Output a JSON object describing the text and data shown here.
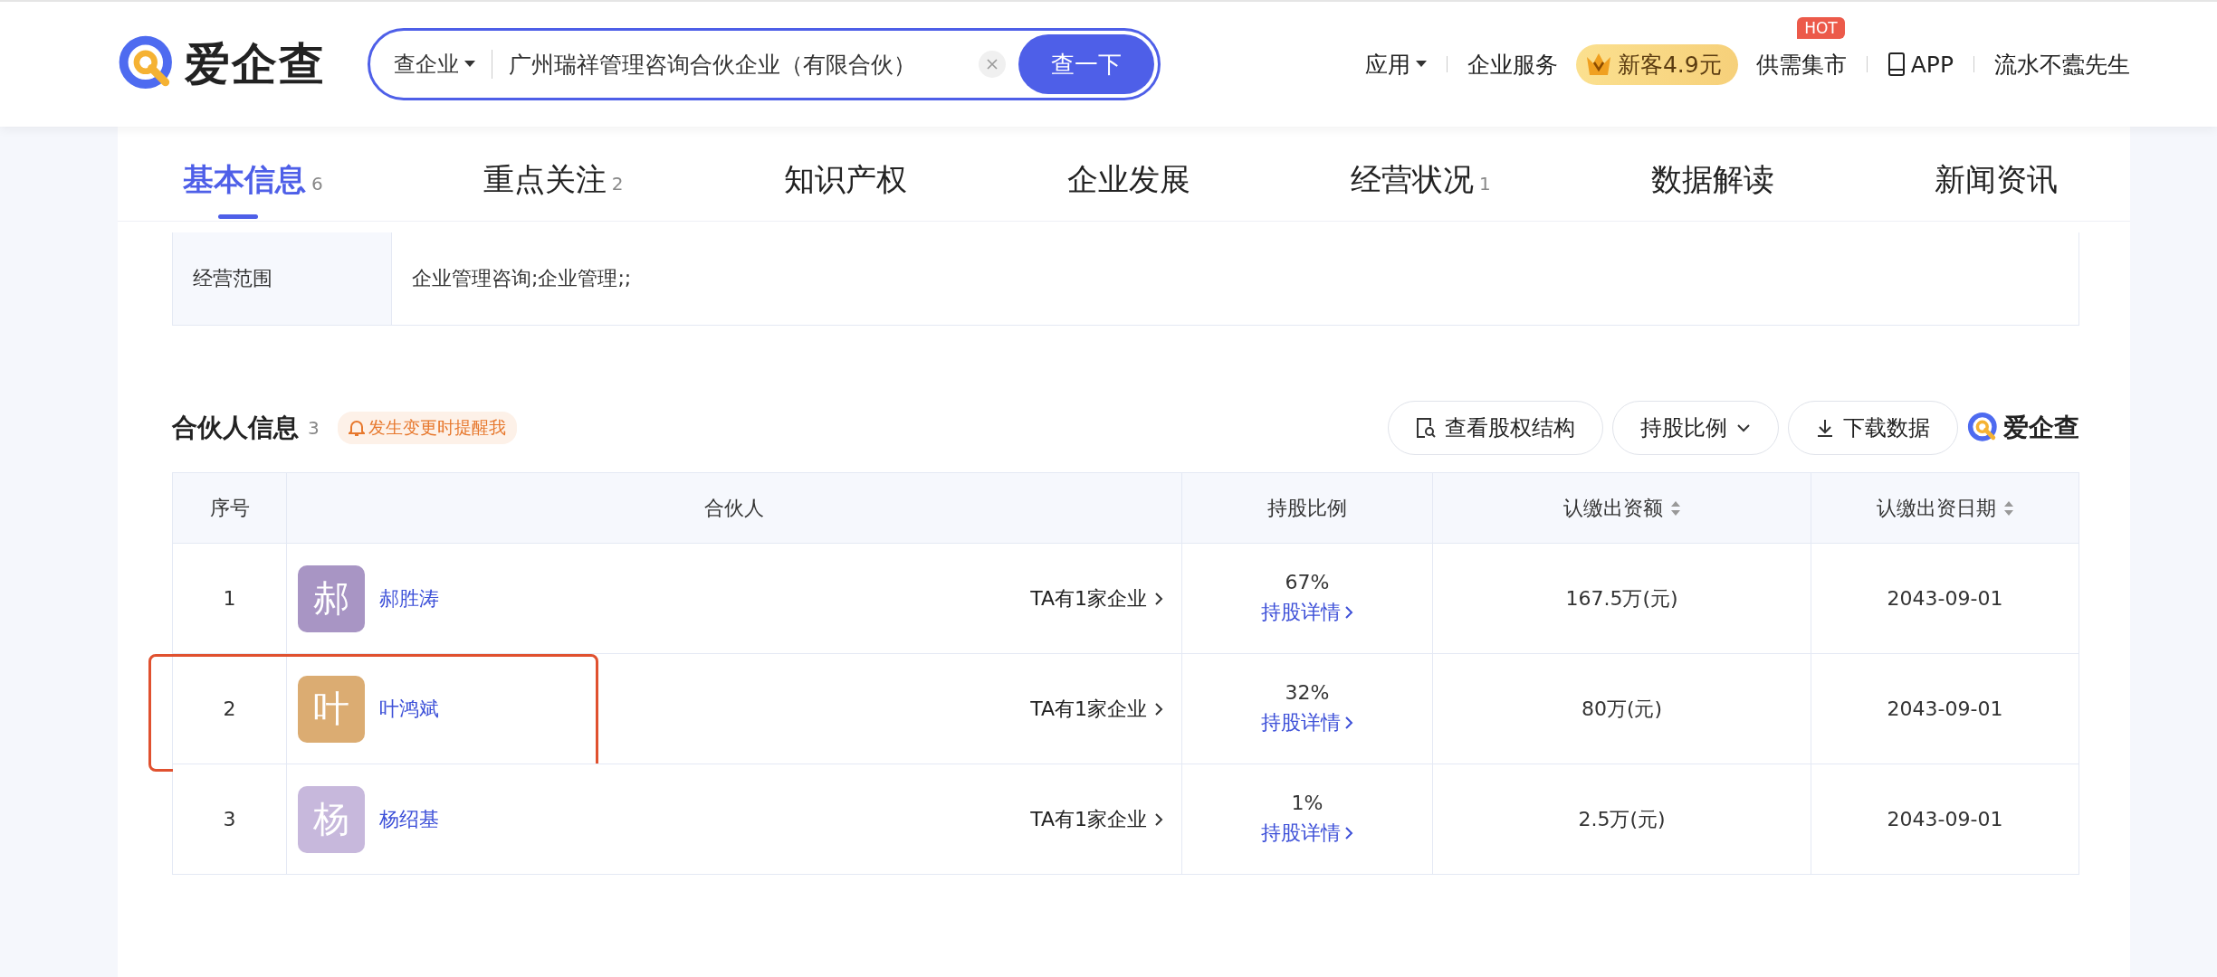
{
  "header": {
    "logo_text": "爱企查",
    "search": {
      "scope": "查企业",
      "value": "广州瑞祥管理咨询合伙企业（有限合伙）",
      "button": "查一下"
    },
    "nav": [
      {
        "kind": "dropdown",
        "label": "应用"
      },
      {
        "kind": "link",
        "label": "企业服务"
      },
      {
        "kind": "promo",
        "label": "新客4.9元"
      },
      {
        "kind": "hot",
        "label": "供需集市",
        "badge": "HOT"
      },
      {
        "kind": "app",
        "label": "APP"
      },
      {
        "kind": "user",
        "label": "流水不蠹先生"
      }
    ]
  },
  "tabs": [
    {
      "label": "基本信息",
      "count": "6",
      "selected": true
    },
    {
      "label": "重点关注",
      "count": "2",
      "selected": false
    },
    {
      "label": "知识产权",
      "selected": false
    },
    {
      "label": "企业发展",
      "selected": false
    },
    {
      "label": "经营状况",
      "count": "1",
      "selected": false
    },
    {
      "label": "数据解读",
      "selected": false
    },
    {
      "label": "新闻资讯",
      "selected": false
    }
  ],
  "business_scope": {
    "label": "经营范围",
    "value": "企业管理咨询;企业管理;;"
  },
  "partners": {
    "title": "合伙人信息",
    "count": "3",
    "remind": "发生变更时提醒我",
    "actions": [
      {
        "kind": "structure",
        "label": "查看股权结构"
      },
      {
        "kind": "dropdown",
        "label": "持股比例"
      },
      {
        "kind": "download",
        "label": "下载数据"
      }
    ],
    "brand": "爱企查",
    "columns": [
      {
        "label": "序号",
        "sortable": false
      },
      {
        "label": "合伙人",
        "sortable": false
      },
      {
        "label": "持股比例",
        "sortable": false
      },
      {
        "label": "认缴出资额",
        "sortable": true
      },
      {
        "label": "认缴出资日期",
        "sortable": true
      }
    ],
    "rows": [
      {
        "index": "1",
        "avatar_text": "郝",
        "color": "#a895c4",
        "name": "郝胜涛",
        "companies": "TA有1家企业",
        "ratio": "67%",
        "detail": "持股详情",
        "amount": "167.5万(元)",
        "date": "2043-09-01",
        "highlighted": false
      },
      {
        "index": "2",
        "avatar_text": "叶",
        "color": "#dbac72",
        "name": "叶鸿斌",
        "companies": "TA有1家企业",
        "ratio": "32%",
        "detail": "持股详情",
        "amount": "80万(元)",
        "date": "2043-09-01",
        "highlighted": true
      },
      {
        "index": "3",
        "avatar_text": "杨",
        "color": "#c7b8dc",
        "name": "杨绍基",
        "companies": "TA有1家企业",
        "ratio": "1%",
        "detail": "持股详情",
        "amount": "2.5万(元)",
        "date": "2043-09-01",
        "highlighted": false
      }
    ]
  }
}
